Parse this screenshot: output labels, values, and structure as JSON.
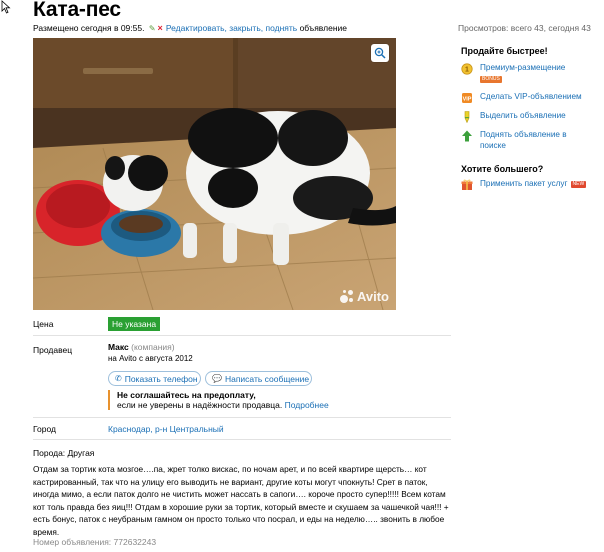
{
  "ad": {
    "title": "Ката-пес",
    "posted_text": "Размещено сегодня в 09:55.",
    "edit_link": "Редактировать, закрыть, поднять",
    "edit_suffix": "объявление",
    "views_text": "Просмотров: всего 43, сегодня 43"
  },
  "photo": {
    "watermark": "Avito"
  },
  "fields": {
    "price_label": "Цена",
    "price_value": "Не указана",
    "seller_label": "Продавец",
    "seller_name": "Макс",
    "seller_company": "(компания)",
    "seller_since": "на Avito с августа 2012",
    "show_phone": "Показать телефон",
    "write_message": "Написать сообщение",
    "warning_bold": "Не соглашайтесь на предоплату,",
    "warning_text": "если не уверены в надёжности продавца.",
    "warning_more": "Подробнее",
    "city_label": "Город",
    "city_value": "Краснодар, р-н Центральный"
  },
  "description": {
    "breed": "Порода: Другая",
    "text": "Отдам за тортик кота мозгое….па, жрет толко вискас, по ночам арет, и по всей квартире щерсть… кот кастрированный, так что на улицу его выводить не вариант, другие коты могут чпокнуть! Срет в паток, иногда мимо, а если паток долго не чистить может нассать в сапоги…. короче просто супер!!!!! Всем котам кот толь правда без яиц!!! Отдам в хорошие руки за тортик, который вместе и скушаем за чашечкой чая!!! + есть бонус, паток с неубраным гамном он просто только что посрал, и еды на неделю….. звонить в любое время.",
    "ad_number": "Номер объявления: 772632243"
  },
  "sidebar": {
    "sell_faster_heading": "Продайте быстрее!",
    "items": [
      {
        "label": "Премиум-размещение",
        "tag": "BONUS",
        "icon": "coin-icon"
      },
      {
        "label": "Сделать VIP-объявлением",
        "icon": "vip-icon"
      },
      {
        "label": "Выделить объявление",
        "icon": "highlighter-icon"
      },
      {
        "label": "Поднять объявление в поиске",
        "icon": "arrow-up-icon"
      }
    ],
    "want_more_heading": "Хотите большего?",
    "package_link": "Применить пакет услуг",
    "package_tag": "NEW",
    "package_icon": "package-icon"
  },
  "colors": {
    "link": "#1a6fb5",
    "price_badge": "#2aa033",
    "warning_bar": "#e8922e"
  }
}
